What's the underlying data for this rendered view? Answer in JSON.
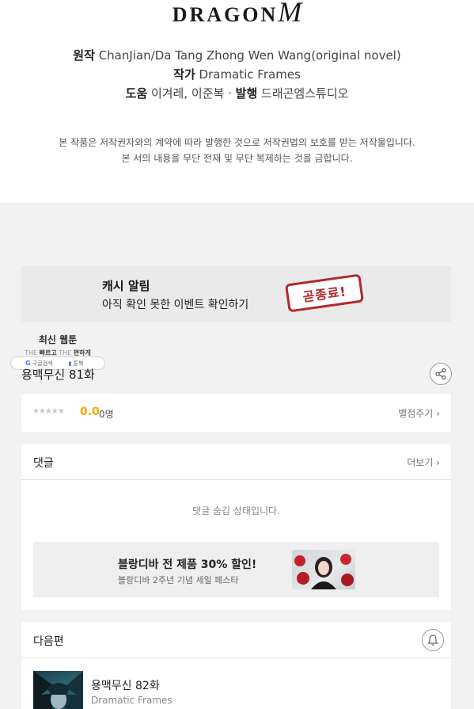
{
  "publisher_logo": {
    "text": "DRAGON",
    "mark": "M"
  },
  "credits": {
    "original_label": "원작",
    "original_value": "ChanJian/Da Tang Zhong Wen Wang(original novel)",
    "author_label": "작가",
    "author_value": "Dramatic Frames",
    "assist_label": "도움",
    "assist_value": "이겨레, 이준복",
    "separator": "·",
    "publish_label": "발행",
    "publish_value": "드래곤엠스튜디오"
  },
  "copyright_notice": [
    "본 작품은 저작권자와의 계약에 따라 발행한 것으로 저작권법의 보호를 받는 저작물입니다.",
    "본 서의 내용을 무단 전재 및 무단 복제하는 것을 금합니다."
  ],
  "cash_alert": {
    "title": "캐시 알림",
    "subtitle": "아직 확인 못한 이벤트 확인하기",
    "stamp_text": "곧종료!"
  },
  "floating_widget": {
    "title": "최신 웹툰",
    "slogan_the1": "THE",
    "slogan_fast": "빠르고",
    "slogan_the2": "THE",
    "slogan_easy": "편하게",
    "google_label": "구글검색",
    "bookmark_label": "툰북"
  },
  "episode": {
    "title": "용맥무신 81화"
  },
  "rating": {
    "stars": "★★★★★",
    "score": "0.0",
    "count": "0명",
    "rate_link": "별점주기"
  },
  "comments": {
    "label": "댓글",
    "more": "더보기",
    "hidden_message": "댓글 숨김 상태입니다."
  },
  "banner_ad": {
    "title": "블랑디바 전 제품 30% 할인!",
    "subtitle": "블랑디바 2주년 기념 세일 페스타"
  },
  "next_episode": {
    "label": "다음편",
    "title": "용맥무신 82화",
    "author": "Dramatic Frames"
  },
  "colors": {
    "score": "#f2a900",
    "stamp": "#b3282d",
    "page_bg": "#f2f2f2"
  }
}
